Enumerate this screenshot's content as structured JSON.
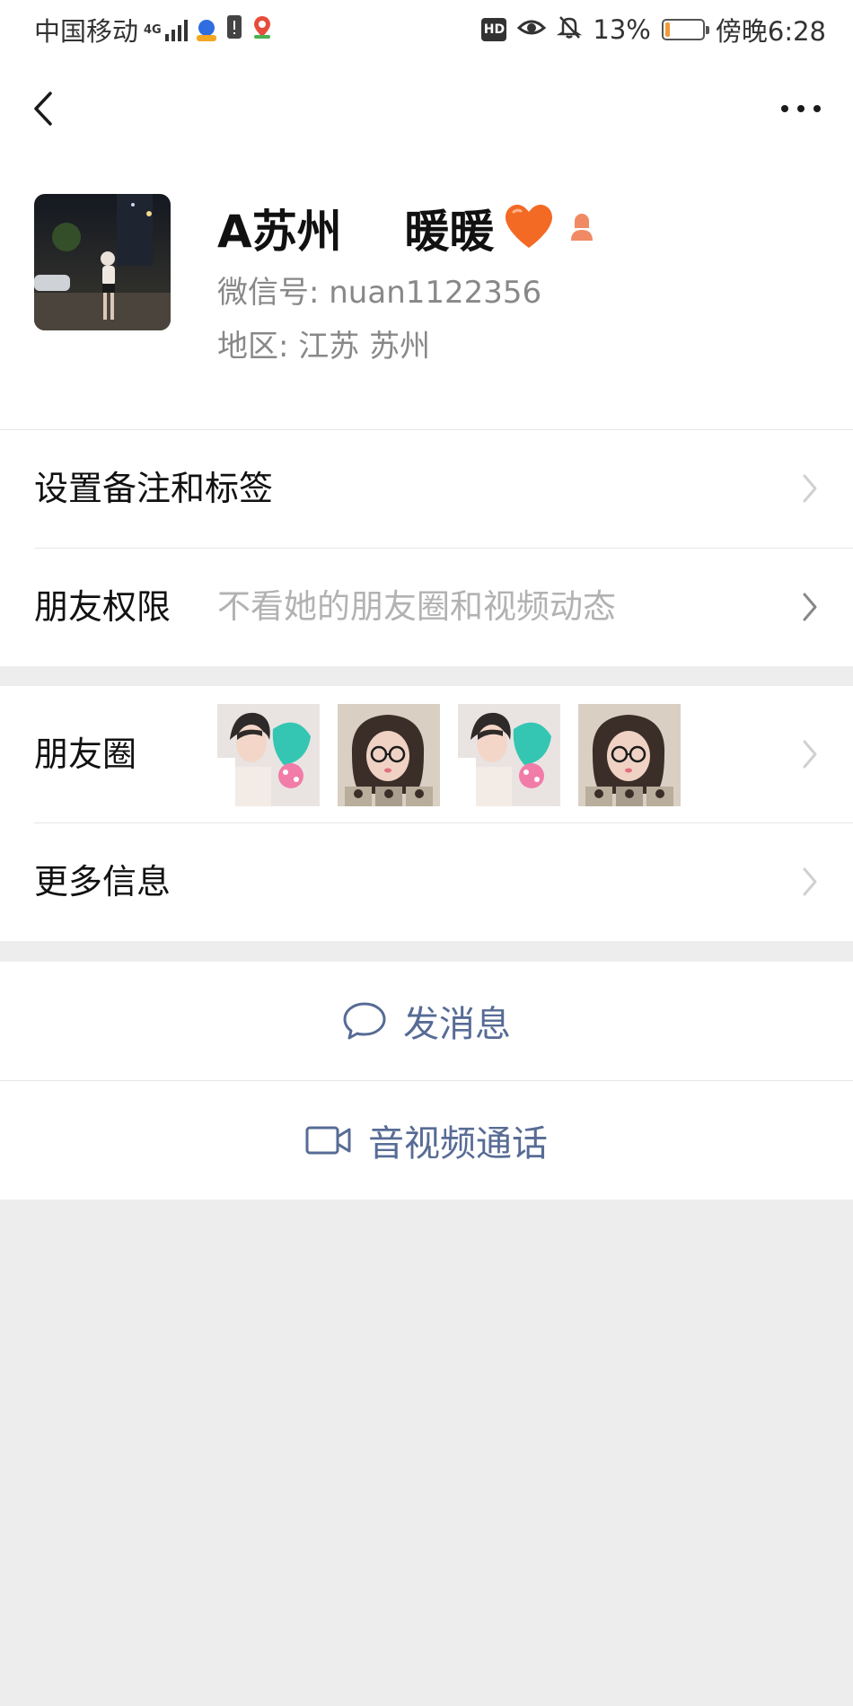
{
  "status_bar": {
    "carrier": "中国移动",
    "network": "4G",
    "battery": "13%",
    "time": "傍晚6:28",
    "battery_level": 0.13,
    "icons": [
      "signal-icon",
      "baidu-app-icon",
      "sim-alert-icon",
      "map-app-icon",
      "hd-icon",
      "eye-comfort-icon",
      "mute-bell-icon",
      "battery-icon"
    ]
  },
  "nav": {
    "back_icon": "chevron-left-icon",
    "more_icon": "more-dots-icon"
  },
  "profile": {
    "name": "A苏州    暖暖",
    "name_emoji_icon": "orange-heart-icon",
    "gender_icon": "female-icon",
    "wechat_id": "微信号: nuan1122356",
    "region": "地区: 江苏  苏州"
  },
  "rows": {
    "remark": {
      "label": "设置备注和标签"
    },
    "permission": {
      "label": "朋友权限",
      "value": "不看她的朋友圈和视频动态"
    },
    "moments": {
      "label": "朋友圈"
    },
    "more_info": {
      "label": "更多信息"
    }
  },
  "actions": {
    "message": {
      "label": "发消息",
      "icon": "chat-bubble-icon"
    },
    "video_call": {
      "label": "音视频通话",
      "icon": "video-camera-icon"
    }
  },
  "colors": {
    "accent": "#576b95",
    "heart": "#f26a24",
    "gender": "#f08a64"
  }
}
